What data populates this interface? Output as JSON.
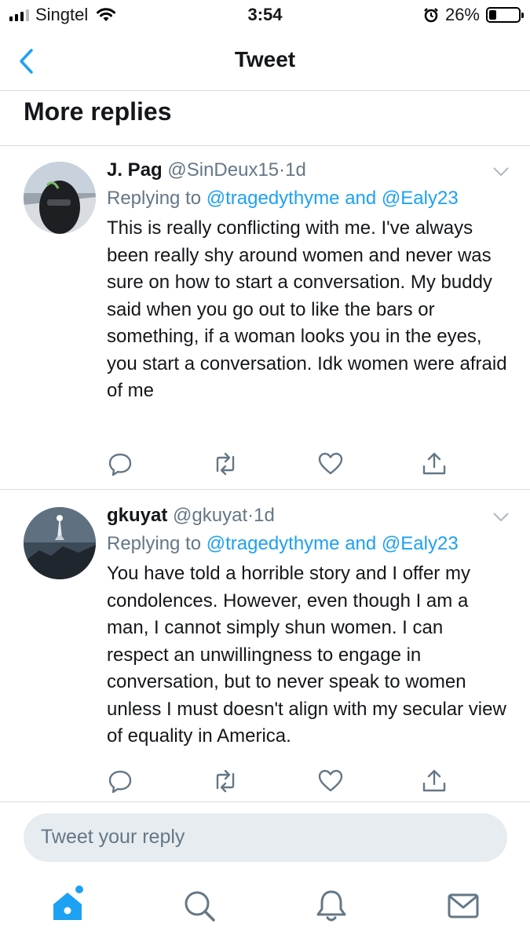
{
  "status_bar": {
    "carrier": "Singtel",
    "time": "3:54",
    "battery_percent": "26%",
    "battery_level": 0.26,
    "icons": [
      "signal-bars-icon",
      "wifi-icon",
      "alarm-icon",
      "battery-icon"
    ]
  },
  "nav": {
    "back_icon": "back-chevron-icon",
    "title": "Tweet"
  },
  "section": {
    "title": "More replies"
  },
  "tweets": [
    {
      "name": "J. Pag",
      "handle": "@SinDeux15",
      "dot": "·",
      "age": "1d",
      "replying_prefix": "Replying to",
      "mention_1": "@tragedythyme",
      "and": "and",
      "mention_2": "@Ealy23",
      "text": "This is really conflicting with me. I've always been really shy around women and never was sure on how to start a conversation. My buddy said when you go out to like the bars or something, if a woman looks you in the eyes, you start a conversation. Idk women were afraid of me"
    },
    {
      "name": "gkuyat",
      "handle": "@gkuyat",
      "dot": "·",
      "age": "1d",
      "replying_prefix": "Replying to",
      "mention_1": "@tragedythyme",
      "and": "and",
      "mention_2": "@Ealy23",
      "text": "You have told a horrible story and I offer my condolences. However, even though I am a man, I cannot simply shun women. I can respect an unwillingness to engage in conversation, but to never speak to women unless I must doesn't align with my secular view of equality in America."
    }
  ],
  "composer": {
    "placeholder": "Tweet your reply"
  },
  "tab_bar": {
    "tabs": [
      "home-icon",
      "search-icon",
      "notifications-bell-icon",
      "messages-envelope-icon"
    ],
    "active": "home-icon"
  },
  "colors": {
    "accent": "#1da1f2",
    "secondary_text": "#657786",
    "divider": "#d8dce0",
    "composer_bg": "#e6ecf0"
  }
}
